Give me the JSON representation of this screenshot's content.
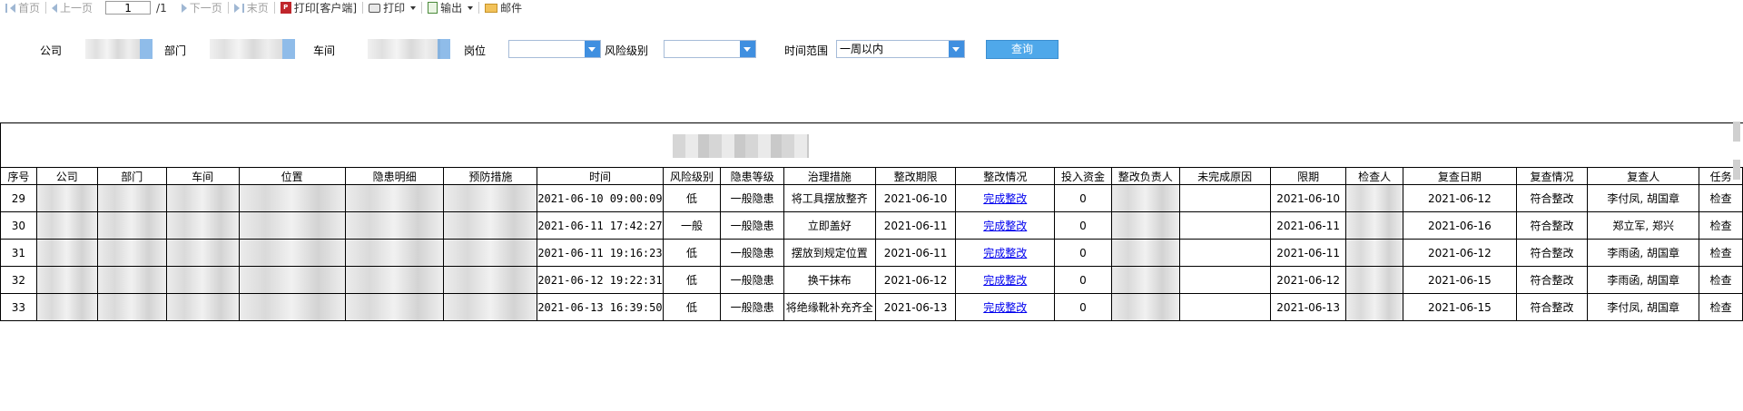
{
  "toolbar": {
    "first": "首页",
    "prev": "上一页",
    "page_value": "1",
    "page_total": "/1",
    "next": "下一页",
    "last": "末页",
    "print_client": "打印[客户端]",
    "print": "打印",
    "export": "输出",
    "mail": "邮件"
  },
  "filters": {
    "company_label": "公司",
    "dept_label": "部门",
    "workshop_label": "车间",
    "post_label": "岗位",
    "risk_label": "风险级别",
    "time_label": "时间范围",
    "time_value": "一周以内",
    "query_label": "查询"
  },
  "table": {
    "headers": [
      "序号",
      "公司",
      "部门",
      "车间",
      "位置",
      "隐患明细",
      "预防措施",
      "时间",
      "风险级别",
      "隐患等级",
      "治理措施",
      "整改期限",
      "整改情况",
      "投入资金",
      "整改负责人",
      "未完成原因",
      "限期",
      "检查人",
      "复查日期",
      "复查情况",
      "复查人",
      "任务"
    ],
    "rows": [
      {
        "no": "29",
        "time": "2021-06-10 09:00:09",
        "risk": "低",
        "level": "一般隐患",
        "measure": "将工具摆放整齐",
        "deadline": "2021-06-10",
        "status": "完成整改",
        "fund": "0",
        "reason": "",
        "limit": "2021-06-10",
        "review_date": "2021-06-12",
        "review_status": "符合整改",
        "reviewer": "李付凤, 胡国章",
        "task": "检查"
      },
      {
        "no": "30",
        "time": "2021-06-11 17:42:27",
        "risk": "一般",
        "level": "一般隐患",
        "measure": "立即盖好",
        "deadline": "2021-06-11",
        "status": "完成整改",
        "fund": "0",
        "reason": "",
        "limit": "2021-06-11",
        "review_date": "2021-06-16",
        "review_status": "符合整改",
        "reviewer": "郑立军, 郑兴",
        "task": "检查"
      },
      {
        "no": "31",
        "time": "2021-06-11 19:16:23",
        "risk": "低",
        "level": "一般隐患",
        "measure": "摆放到规定位置",
        "deadline": "2021-06-11",
        "status": "完成整改",
        "fund": "0",
        "reason": "",
        "limit": "2021-06-11",
        "review_date": "2021-06-12",
        "review_status": "符合整改",
        "reviewer": "李雨函, 胡国章",
        "task": "检查"
      },
      {
        "no": "32",
        "time": "2021-06-12 19:22:31",
        "risk": "低",
        "level": "一般隐患",
        "measure": "换干抹布",
        "deadline": "2021-06-12",
        "status": "完成整改",
        "fund": "0",
        "reason": "",
        "limit": "2021-06-12",
        "review_date": "2021-06-15",
        "review_status": "符合整改",
        "reviewer": "李雨函, 胡国章",
        "task": "检查"
      },
      {
        "no": "33",
        "time": "2021-06-13 16:39:50",
        "risk": "低",
        "level": "一般隐患",
        "measure": "将绝缘靴补充齐全",
        "deadline": "2021-06-13",
        "status": "完成整改",
        "fund": "0",
        "reason": "",
        "limit": "2021-06-13",
        "review_date": "2021-06-15",
        "review_status": "符合整改",
        "reviewer": "李付凤, 胡国章",
        "task": "检查"
      }
    ]
  }
}
